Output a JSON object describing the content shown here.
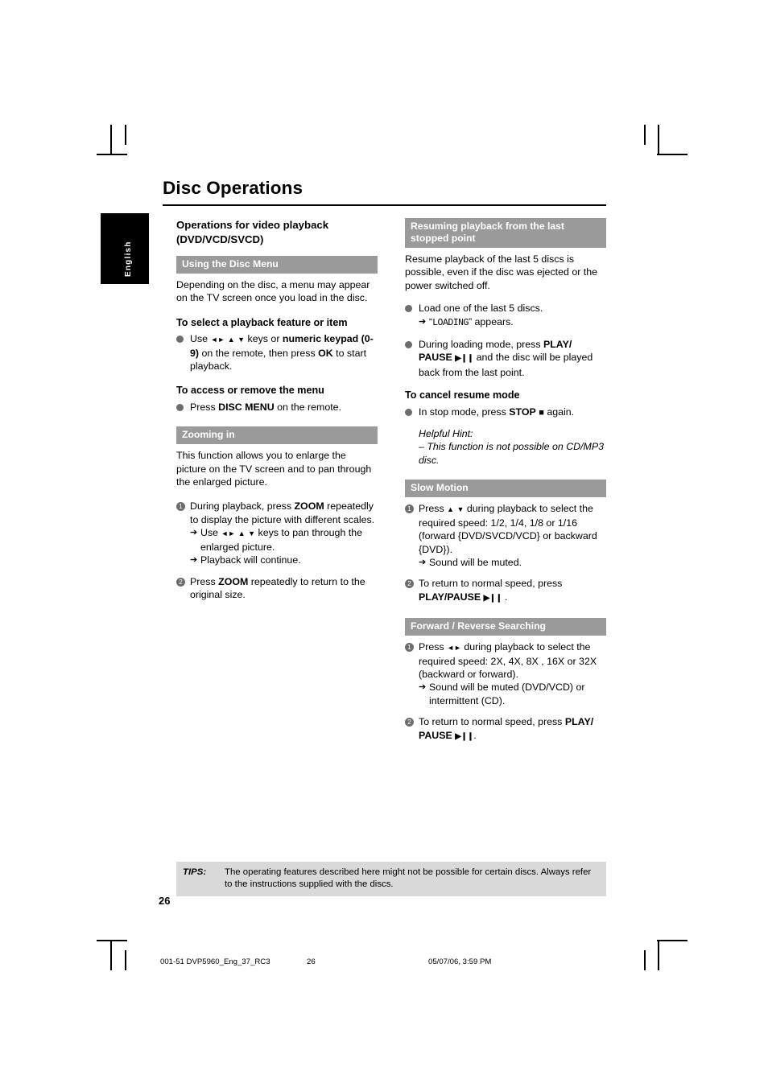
{
  "title": "Disc Operations",
  "language_tab": "English",
  "left_column": {
    "section_heading_line1": "Operations for video playback",
    "section_heading_line2": "(DVD/VCD/SVCD)",
    "disc_menu_bar": "Using the Disc Menu",
    "disc_menu_body": "Depending on the disc, a menu may appear on the TV screen once you load in the disc.",
    "select_feature_head": "To select a playback feature or item",
    "select_feature_item": "Use ◄► ▲ ▼ keys or numeric keypad (0-9) on the remote, then press OK to start playback.",
    "access_menu_head": "To access or remove the menu",
    "access_menu_item": "Press DISC MENU on the remote.",
    "zoom_bar": "Zooming in",
    "zoom_body": "This function allows you to enlarge the picture on the TV screen and to pan through the enlarged picture.",
    "zoom_step1": "During playback, press ZOOM repeatedly to display the picture with different scales.",
    "zoom_step1_sub1": "Use ◄► ▲ ▼ keys to pan through the enlarged picture.",
    "zoom_step1_sub2": "Playback will continue.",
    "zoom_step2": "Press ZOOM repeatedly to return to the original size."
  },
  "right_column": {
    "resume_bar_line1": "Resuming playback from the last",
    "resume_bar_line2": "stopped point",
    "resume_body": "Resume playback of the last 5 discs is possible, even if the disc was ejected or the power switched off.",
    "resume_item1": "Load one of the last 5 discs.",
    "resume_item1_sub": "“LOADING” appears.",
    "resume_item1_sub_lcd": "LOADING",
    "resume_item2": "During loading mode, press PLAY/ PAUSE ►Ⅱ and the disc will be played back from the last point.",
    "cancel_head": "To cancel resume mode",
    "cancel_item": "In stop mode, press STOP ■ again.",
    "hint_label": "Helpful Hint:",
    "hint_text": "– This function is not possible on CD/MP3 disc.",
    "slow_bar": "Slow Motion",
    "slow_step1": "Press ▲ ▼ during playback to select the required speed: 1/2, 1/4, 1/8 or 1/16 (forward {DVD/SVCD/VCD} or backward {DVD}).",
    "slow_step1_sub": "Sound will be muted.",
    "slow_step2": "To return to normal speed, press PLAY/PAUSE ►Ⅱ .",
    "search_bar": "Forward / Reverse Searching",
    "search_step1": "Press ◄► during playback to select the required speed: 2X, 4X, 8X , 16X or 32X (backward or forward).",
    "search_step1_sub1": "Sound will be muted (DVD/VCD) or intermittent (CD).",
    "search_step2": "To return to normal speed, press PLAY/ PAUSE ►Ⅱ."
  },
  "tips": {
    "label": "TIPS:",
    "text": "The operating features described here might not be possible for certain discs.  Always refer to the instructions supplied with the discs."
  },
  "page_number": "26",
  "footer": {
    "file": "001-51 DVP5960_Eng_37_RC3",
    "page": "26",
    "date": "05/07/06, 3:59 PM"
  }
}
